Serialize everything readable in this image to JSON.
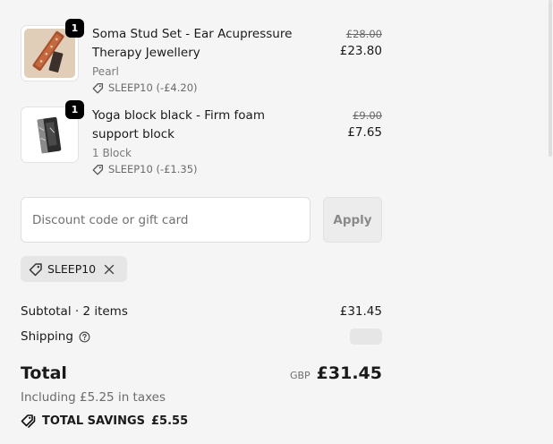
{
  "colors": {
    "background": "#f5f5f5",
    "badge": "#000000",
    "button_disabled_bg": "#ececec",
    "muted_text": "#707070"
  },
  "items": [
    {
      "quantity": "1",
      "title": "Soma Stud Set - Ear Acupressure Therapy Jewellery",
      "variant": "Pearl",
      "discount": "SLEEP10 (-£4.20)",
      "original_price": "£28.00",
      "price": "£23.80",
      "icon": "tag-icon"
    },
    {
      "quantity": "1",
      "title": "Yoga block black - Firm foam support block",
      "variant": "1 Block",
      "discount": "SLEEP10 (-£1.35)",
      "original_price": "£9.00",
      "price": "£7.65",
      "icon": "tag-icon"
    }
  ],
  "discount_form": {
    "placeholder": "Discount code or gift card",
    "value": "",
    "apply_label": "Apply"
  },
  "applied_code": {
    "code": "SLEEP10",
    "icon": "tag-icon",
    "remove_icon": "close-icon"
  },
  "summary": {
    "subtotal_label": "Subtotal · 2 items",
    "subtotal_value": "£31.45",
    "shipping_label": "Shipping",
    "shipping_icon": "help-circle-icon",
    "total_label": "Total",
    "currency": "GBP",
    "total_value": "£31.45",
    "tax_note": "Including £5.25 in taxes",
    "savings_label": "TOTAL SAVINGS",
    "savings_value": "£5.55",
    "savings_icon": "tags-icon"
  }
}
